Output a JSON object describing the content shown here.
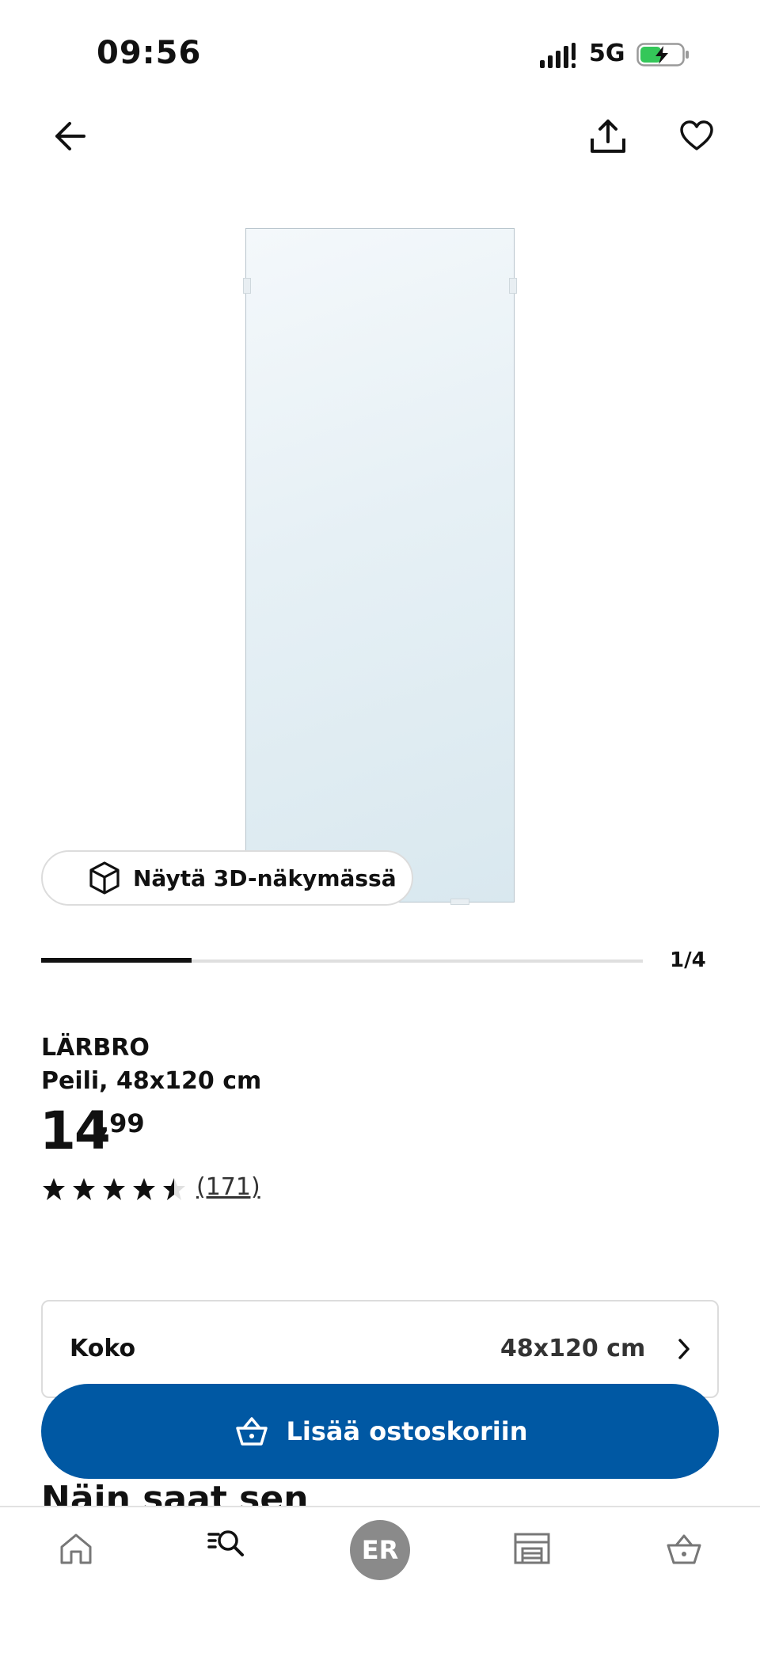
{
  "status_bar": {
    "time": "09:56",
    "network": "5G"
  },
  "product": {
    "name": "LÄRBRO",
    "description": "Peili, 48x120 cm",
    "price_integer": "14",
    "price_decimal": ",99",
    "rating": 4.5,
    "rating_max": 5,
    "reviews": "(171)"
  },
  "gallery": {
    "view_3d_label": "Näytä 3D-näkymässä",
    "counter": "1/4",
    "progress": 0.25
  },
  "size_selector": {
    "label": "Koko",
    "value": "48x120 cm"
  },
  "cart_button": {
    "label": "Lisää ostoskoriin"
  },
  "section_peek": {
    "title": "Näin saat sen"
  },
  "bottom_nav": {
    "avatar_initials": "ER",
    "icons": [
      "home-icon",
      "search-icon",
      "profile-avatar",
      "store-icon",
      "cart-icon"
    ]
  },
  "colors": {
    "primary_blue": "#0058a3",
    "text": "#111111",
    "border": "#dcdcdc",
    "battery_green": "#34c759"
  }
}
